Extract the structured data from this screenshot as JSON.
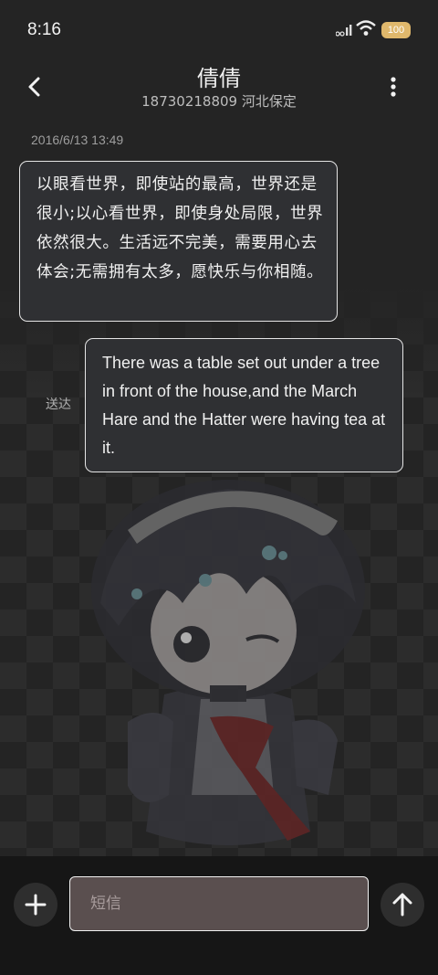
{
  "status_bar": {
    "time": "8:16",
    "battery": "100"
  },
  "header": {
    "contact_name": "倩倩",
    "contact_subtitle": "18730218809 河北保定"
  },
  "conversation": {
    "timestamp": "2016/6/13 13:49",
    "incoming_message": "以眼看世界，即使站的最高，世界还是很小;以心看世界，即使身处局限，世界依然很大。生活远不完美，需要用心去体会;无需拥有太多，愿快乐与你相随。",
    "outgoing_message": "There was a table set out under a tree in front of the house,and the March Hare and the Hatter were having tea at it.",
    "outgoing_status": "送达"
  },
  "composer": {
    "placeholder": "短信"
  },
  "colors": {
    "background": "#242424",
    "bubble_border": "#e5e5e5",
    "input_background": "#5a4f4f",
    "battery": "#e0b86c"
  }
}
